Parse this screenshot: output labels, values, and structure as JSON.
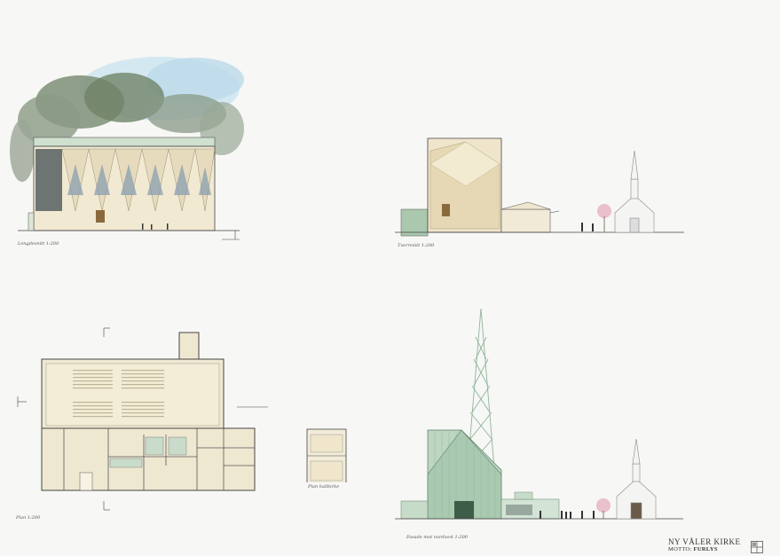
{
  "drawings": {
    "long_section": {
      "caption": "Lengdesnitt 1:200"
    },
    "cross_section": {
      "caption": "Tverrsnitt 1:200"
    },
    "plan": {
      "caption": "Plan 1:200"
    },
    "plan_gallery": {
      "caption": "Plan hallkirke"
    },
    "facade": {
      "caption": "Fasade mot nordvest 1:200"
    }
  },
  "title_block": {
    "project": "NY VÅLER KIRKE",
    "motto_label": "MOTTO:",
    "motto": "FURLYS"
  },
  "colors": {
    "background": "#f7f7f5",
    "wood": "#eee4c8",
    "green": "#bcd6c2",
    "line": "#444444",
    "sky": "#c9e2ef",
    "trees": "#6d7f6a"
  }
}
